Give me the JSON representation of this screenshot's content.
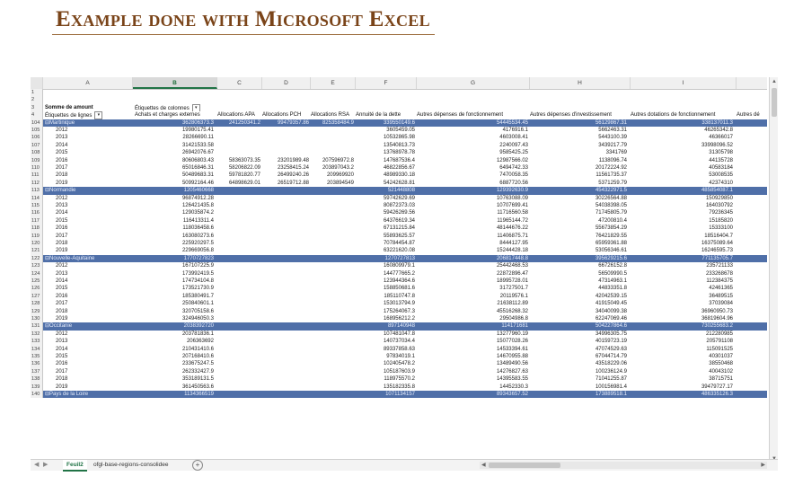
{
  "title": "Example done with Microsoft Excel",
  "columns": [
    "A",
    "B",
    "C",
    "D",
    "E",
    "F",
    "G",
    "H",
    "I"
  ],
  "selected_column": "B",
  "pivot": {
    "value_label": "Somme de amount",
    "col_label": "Étiquettes de colonnes",
    "row_label": "Étiquettes de lignes",
    "headers": [
      "Achats et charges externes",
      "Allocations APA",
      "Allocations PCH",
      "Allocations RSA",
      "Annuité de la dette",
      "Autres dépenses de fonctionnement",
      "Autres dépenses d'investissement",
      "Autres dotations de fonctionnement",
      "Autres dé"
    ]
  },
  "rows": [
    {
      "n": "1",
      "t": "blank",
      "cells": []
    },
    {
      "n": "2",
      "t": "blank",
      "cells": []
    },
    {
      "n": "3",
      "t": "hdr",
      "cells": []
    },
    {
      "n": "4",
      "t": "hdr2",
      "cells": []
    },
    {
      "n": "104",
      "t": "group",
      "label": "⊟Martinique",
      "cells": [
        "362806373.3",
        "241250341.2",
        "99479357.86",
        "825358484.9",
        "339550149.6",
        "54445534.45",
        "56129867.31",
        "338137011.3"
      ]
    },
    {
      "n": "105",
      "t": "data",
      "label": "2012",
      "cells": [
        "19980175.41",
        "",
        "",
        "",
        "3605459.05",
        "4176916.1",
        "5662463.31",
        "46265342.8"
      ]
    },
    {
      "n": "106",
      "t": "data",
      "label": "2013",
      "cells": [
        "28266690.11",
        "",
        "",
        "",
        "10532865.98",
        "4603008.41",
        "5443100.39",
        "46366017"
      ]
    },
    {
      "n": "107",
      "t": "data",
      "label": "2014",
      "cells": [
        "31421533.58",
        "",
        "",
        "",
        "13540813.73",
        "2240097.43",
        "3439217.79",
        "33998096.52"
      ]
    },
    {
      "n": "108",
      "t": "data",
      "label": "2015",
      "cells": [
        "26942076.67",
        "",
        "",
        "",
        "13768978.78",
        "9585425.25",
        "3341769",
        "31305798"
      ]
    },
    {
      "n": "109",
      "t": "data",
      "label": "2016",
      "cells": [
        "80606803.43",
        "58363073.35",
        "23201989.48",
        "207596972.8",
        "147687536.4",
        "12987566.02",
        "1138096.74",
        "44135728"
      ]
    },
    {
      "n": "110",
      "t": "data",
      "label": "2017",
      "cells": [
        "65016846.31",
        "58206822.09",
        "23258415.24",
        "203897043.2",
        "46822856.67",
        "6494742.33",
        "20172224.92",
        "40583184"
      ]
    },
    {
      "n": "111",
      "t": "data",
      "label": "2018",
      "cells": [
        "50489683.31",
        "59781820.77",
        "26499240.26",
        "209969920",
        "48989330.18",
        "7470058.35",
        "11561735.37",
        "53008535"
      ]
    },
    {
      "n": "112",
      "t": "data",
      "label": "2019",
      "cells": [
        "50992164.46",
        "64898629.01",
        "26519712.88",
        "203894549",
        "54242628.81",
        "6887720.56",
        "5371259.79",
        "42374310"
      ]
    },
    {
      "n": "113",
      "t": "group",
      "label": "⊟Normandie",
      "cells": [
        "1205460668",
        "",
        "",
        "",
        "521448808",
        "129392630.9",
        "454322971.5",
        "485854087.1"
      ]
    },
    {
      "n": "114",
      "t": "data",
      "label": "2012",
      "cells": [
        "96874912.28",
        "",
        "",
        "",
        "59742629.69",
        "10763088.09",
        "30226564.88",
        "150929850"
      ]
    },
    {
      "n": "115",
      "t": "data",
      "label": "2013",
      "cells": [
        "126421435.8",
        "",
        "",
        "",
        "80872373.03",
        "10707699.41",
        "54038398.05",
        "164030792"
      ]
    },
    {
      "n": "116",
      "t": "data",
      "label": "2014",
      "cells": [
        "129035874.2",
        "",
        "",
        "",
        "59426269.56",
        "11716560.58",
        "71745805.79",
        "79236345"
      ]
    },
    {
      "n": "117",
      "t": "data",
      "label": "2015",
      "cells": [
        "116413311.4",
        "",
        "",
        "",
        "64376619.34",
        "11965144.72",
        "47200810.4",
        "15185820"
      ]
    },
    {
      "n": "118",
      "t": "data",
      "label": "2016",
      "cells": [
        "118036458.6",
        "",
        "",
        "",
        "67131215.84",
        "48144676.22",
        "55673854.29",
        "15333100"
      ]
    },
    {
      "n": "119",
      "t": "data",
      "label": "2017",
      "cells": [
        "163080273.6",
        "",
        "",
        "",
        "55893625.57",
        "11406875.71",
        "76421829.55",
        "18516404.7"
      ]
    },
    {
      "n": "120",
      "t": "data",
      "label": "2018",
      "cells": [
        "225920297.5",
        "",
        "",
        "",
        "70784454.87",
        "8444127.95",
        "65959361.88",
        "16375089.64"
      ]
    },
    {
      "n": "121",
      "t": "data",
      "label": "2019",
      "cells": [
        "229669056.8",
        "",
        "",
        "",
        "63221620.08",
        "15244428.18",
        "53056346.61",
        "16246595.73"
      ]
    },
    {
      "n": "122",
      "t": "group",
      "label": "⊟Nouvelle-Aquitaine",
      "cells": [
        "1770727823",
        "",
        "",
        "",
        "1270727813",
        "206817448.8",
        "395629215.6",
        "771135705.7"
      ]
    },
    {
      "n": "123",
      "t": "data",
      "label": "2012",
      "cells": [
        "167107225.9",
        "",
        "",
        "",
        "160809979.1",
        "25442468.53",
        "66726152.8",
        "235721133"
      ]
    },
    {
      "n": "124",
      "t": "data",
      "label": "2013",
      "cells": [
        "173992419.5",
        "",
        "",
        "",
        "144777665.2",
        "22872896.47",
        "56509990.5",
        "233268678"
      ]
    },
    {
      "n": "125",
      "t": "data",
      "label": "2014",
      "cells": [
        "174734104.8",
        "",
        "",
        "",
        "123944364.6",
        "18995728.01",
        "47314963.1",
        "112384375"
      ]
    },
    {
      "n": "126",
      "t": "data",
      "label": "2015",
      "cells": [
        "173521730.9",
        "",
        "",
        "",
        "158850681.6",
        "31727501.7",
        "44833351.8",
        "42461365"
      ]
    },
    {
      "n": "127",
      "t": "data",
      "label": "2016",
      "cells": [
        "185380491.7",
        "",
        "",
        "",
        "185110747.8",
        "20119576.1",
        "42042539.15",
        "36489515"
      ]
    },
    {
      "n": "128",
      "t": "data",
      "label": "2017",
      "cells": [
        "250840601.1",
        "",
        "",
        "",
        "153013794.9",
        "21638112.89",
        "41915049.45",
        "37039084"
      ]
    },
    {
      "n": "129",
      "t": "data",
      "label": "2018",
      "cells": [
        "320705158.6",
        "",
        "",
        "",
        "175264067.3",
        "45516268.32",
        "34040099.38",
        "36960950.73"
      ]
    },
    {
      "n": "130",
      "t": "data",
      "label": "2019",
      "cells": [
        "324946050.3",
        "",
        "",
        "",
        "168956212.2",
        "29504986.8",
        "62247069.46",
        "36819604.96"
      ]
    },
    {
      "n": "131",
      "t": "group",
      "label": "⊟Occitanie",
      "cells": [
        "2038392720",
        "",
        "",
        "",
        "897140948",
        "114171681",
        "504227864.6",
        "730255683.2"
      ]
    },
    {
      "n": "132",
      "t": "data",
      "label": "2012",
      "cells": [
        "203781836.1",
        "",
        "",
        "",
        "107481047.8",
        "13277960.19",
        "34996305.75",
        "212280985"
      ]
    },
    {
      "n": "133",
      "t": "data",
      "label": "2013",
      "cells": [
        "206363692",
        "",
        "",
        "",
        "140737034.4",
        "15077028.26",
        "40159723.19",
        "205791108"
      ]
    },
    {
      "n": "134",
      "t": "data",
      "label": "2014",
      "cells": [
        "210431410.6",
        "",
        "",
        "",
        "89337858.63",
        "14533394.61",
        "47074529.63",
        "115091525"
      ]
    },
    {
      "n": "135",
      "t": "data",
      "label": "2015",
      "cells": [
        "207168410.6",
        "",
        "",
        "",
        "97834019.1",
        "14670955.88",
        "67044714.79",
        "40301037"
      ]
    },
    {
      "n": "136",
      "t": "data",
      "label": "2016",
      "cells": [
        "233675247.5",
        "",
        "",
        "",
        "102405478.2",
        "13489490.56",
        "43518229.06",
        "38550468"
      ]
    },
    {
      "n": "137",
      "t": "data",
      "label": "2017",
      "cells": [
        "262332427.9",
        "",
        "",
        "",
        "105187603.9",
        "14276827.63",
        "100236124.9",
        "40043102"
      ]
    },
    {
      "n": "138",
      "t": "data",
      "label": "2018",
      "cells": [
        "353189131.5",
        "",
        "",
        "",
        "118975570.2",
        "14395583.55",
        "71041255.87",
        "38715751"
      ]
    },
    {
      "n": "139",
      "t": "data",
      "label": "2019",
      "cells": [
        "361450563.6",
        "",
        "",
        "",
        "135182335.8",
        "14452330.3",
        "100156981.4",
        "39479727.17"
      ]
    },
    {
      "n": "140",
      "t": "group",
      "label": "⊟Pays de la Loire",
      "cells": [
        "1134366519",
        "",
        "",
        "",
        "1071134157",
        "89343657.52",
        "173889518.1",
        "486335126.3"
      ]
    }
  ],
  "tabs": {
    "active": "Feuil2",
    "other": "ofgl-base-regions-consolidee"
  }
}
